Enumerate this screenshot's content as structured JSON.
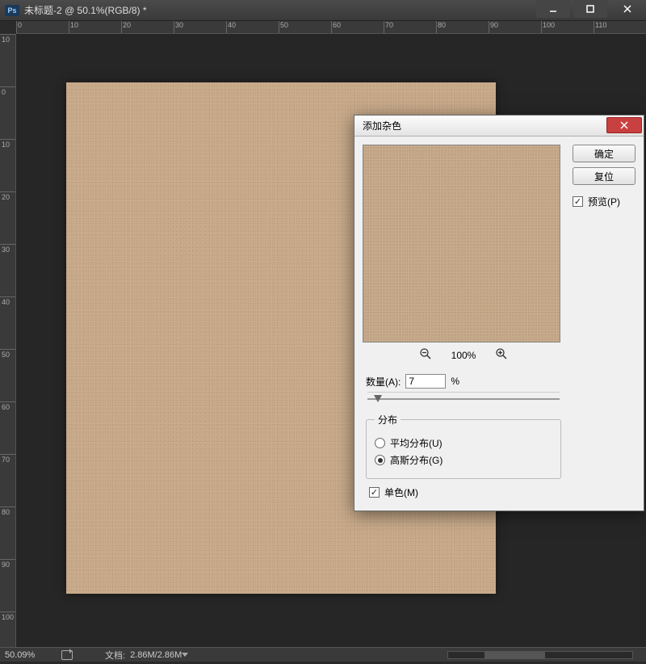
{
  "app": {
    "badge": "Ps"
  },
  "titlebar": {
    "text": "未标题-2 @ 50.1%(RGB/8) *"
  },
  "ruler_h": [
    "0",
    "10",
    "20",
    "30",
    "40",
    "50",
    "60",
    "70",
    "80",
    "90",
    "100",
    "110"
  ],
  "ruler_v": [
    "10",
    "0",
    "10",
    "20",
    "30",
    "40",
    "50",
    "60",
    "70",
    "80",
    "90",
    "100"
  ],
  "statusbar": {
    "zoom": "50.09%",
    "docinfo_label": "文档:",
    "docinfo_value": "2.86M/2.86M"
  },
  "dialog": {
    "title": "添加杂色",
    "ok": "确定",
    "cancel": "复位",
    "preview_label": "预览(P)",
    "preview_checked": true,
    "zoom_label": "100%",
    "amount": {
      "label": "数量(A):",
      "value": "7",
      "unit": "%"
    },
    "distribution": {
      "legend": "分布",
      "uniform": "平均分布(U)",
      "gaussian": "高斯分布(G)",
      "selected": "gaussian"
    },
    "mono": {
      "label": "单色(M)",
      "checked": true
    }
  }
}
